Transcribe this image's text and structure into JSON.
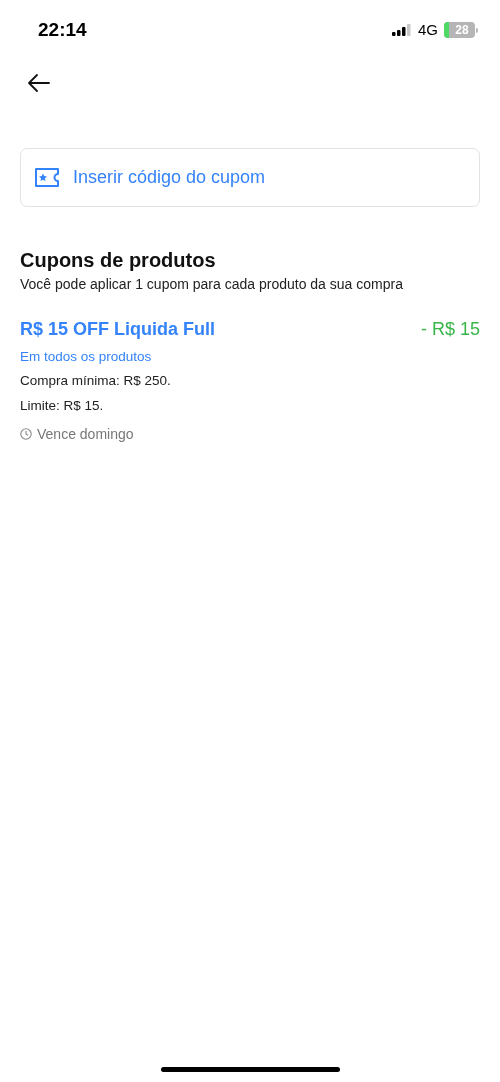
{
  "status_bar": {
    "time": "22:14",
    "network": "4G",
    "battery": "28"
  },
  "coupon_input": {
    "placeholder": "Inserir código do cupom"
  },
  "section": {
    "title": "Cupons de produtos",
    "subtitle": "Você pode aplicar 1 cupom para cada produto da sua compra"
  },
  "coupons": [
    {
      "title": "R$ 15 OFF Liquida Full",
      "discount": "- R$ 15",
      "scope": "Em todos os produtos",
      "details": [
        "Compra mínima: R$ 250.",
        "Limite: R$ 15."
      ],
      "expiry": "Vence domingo"
    }
  ]
}
